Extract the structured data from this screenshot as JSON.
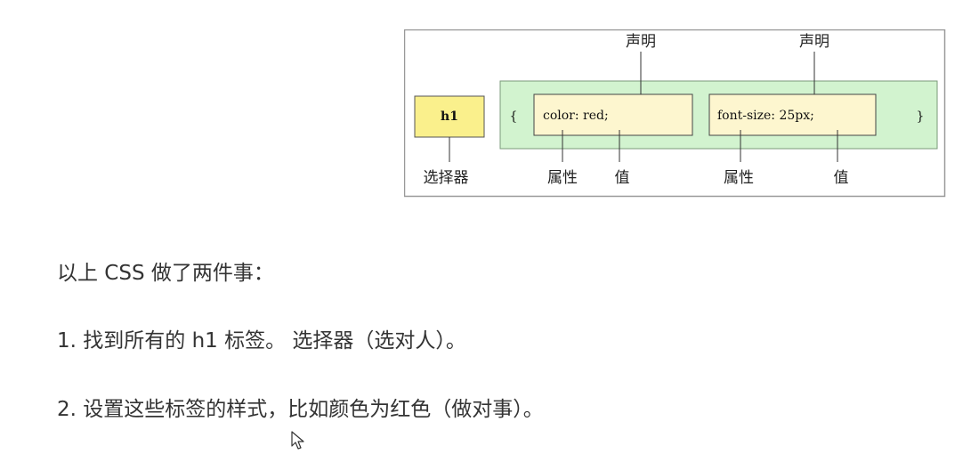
{
  "diagram": {
    "selector_tag": "h1",
    "open_brace": "{",
    "close_brace": "}",
    "decl1": "color: red;",
    "decl2": "font-size: 25px;",
    "decl_label_1": "声明",
    "decl_label_2": "声明",
    "selector_label": "选择器",
    "property_label_1": "属性",
    "value_label_1": "值",
    "property_label_2": "属性",
    "value_label_2": "值",
    "colors": {
      "selector_fill": "#faf08c",
      "block_fill": "#d2f3cf",
      "decl_fill": "#fdf6cf",
      "frame": "#999999"
    }
  },
  "lines": [
    "以上 CSS 做了两件事：",
    "1. 找到所有的 h1 标签。 选择器（选对人）。",
    "2. 设置这些标签的样式，比如颜色为红色（做对事）。"
  ],
  "cursor_icon": "mouse-pointer-icon"
}
